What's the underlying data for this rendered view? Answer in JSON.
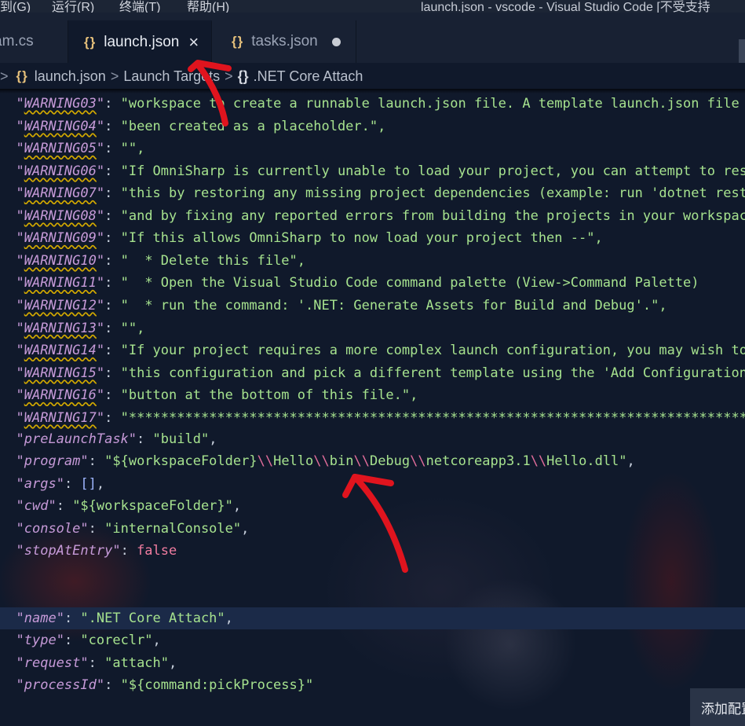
{
  "menubar": {
    "items": [
      "到(G)",
      "运行(R)",
      "终端(T)",
      "帮助(H)"
    ],
    "window_title": "launch.json - vscode - Visual Studio Code [不受支持"
  },
  "tabs": [
    {
      "label": "am.cs",
      "icon": "",
      "active": false
    },
    {
      "label": "launch.json",
      "icon": "{}",
      "active": true,
      "control": "×"
    },
    {
      "label": "tasks.json",
      "icon": "{}",
      "active": false,
      "control": "●"
    }
  ],
  "breadcrumb": {
    "lead_sep": ">",
    "file_icon": "{}",
    "file": "launch.json",
    "segment": "Launch Targets",
    "obj_icon": "{}",
    "object": ".NET Core Attach"
  },
  "code_lines": [
    {
      "key": "WARNING03",
      "value": "workspace to create a runnable launch.json file. A template launch.json file has"
    },
    {
      "key": "WARNING04",
      "value": "been created as a placeholder.\","
    },
    {
      "key": "WARNING05",
      "value": "\","
    },
    {
      "key": "WARNING06",
      "value": "If OmniSharp is currently unable to load your project, you can attempt to resolve"
    },
    {
      "key": "WARNING07",
      "value": "this by restoring any missing project dependencies (example: run 'dotnet restore')"
    },
    {
      "key": "WARNING08",
      "value": "and by fixing any reported errors from building the projects in your workspace."
    },
    {
      "key": "WARNING09",
      "value": "If this allows OmniSharp to now load your project then --\","
    },
    {
      "key": "WARNING10",
      "value": "  * Delete this file\","
    },
    {
      "key": "WARNING11",
      "value": "  * Open the Visual Studio Code command palette (View->Command Palette)"
    },
    {
      "key": "WARNING12",
      "value": "  * run the command: '.NET: Generate Assets for Build and Debug'.\","
    },
    {
      "key": "WARNING13",
      "value": "\","
    },
    {
      "key": "WARNING14",
      "value": "If your project requires a more complex launch configuration, you may wish to delete"
    },
    {
      "key": "WARNING15",
      "value": "this configuration and pick a different template using the 'Add Configuration...'"
    },
    {
      "key": "WARNING16",
      "value": "button at the bottom of this file.\","
    },
    {
      "key": "WARNING17",
      "value": "**********************************************************************************"
    }
  ],
  "config": {
    "preLaunchTask_key": "preLaunchTask",
    "preLaunchTask_val": "\"build\"",
    "program_key": "program",
    "program_parts": [
      "\"${workspaceFolder}",
      "\\\\",
      "Hello",
      "\\\\",
      "bin",
      "\\\\",
      "Debug",
      "\\\\",
      "netcoreapp3.1",
      "\\\\",
      "Hello.dll\""
    ],
    "args_key": "args",
    "args_val": "[]",
    "cwd_key": "cwd",
    "cwd_val": "\"${workspaceFolder}\"",
    "console_key": "console",
    "console_val": "\"internalConsole\"",
    "stopAtEntry_key": "stopAtEntry",
    "stopAtEntry_val": "false"
  },
  "attach": {
    "name_key": "name",
    "name_val": "\".NET Core Attach\"",
    "type_key": "type",
    "type_val": "\"coreclr\"",
    "request_key": "request",
    "request_val": "\"attach\"",
    "processId_key": "processId",
    "processId_val": "\"${command:pickProcess}\""
  },
  "corner_button": "添加配置",
  "colors": {
    "editor_bg": "#10192b",
    "key": "#c69ad8",
    "string": "#a6e28e",
    "escape": "#e06c9a",
    "annotation": "#e0141e"
  }
}
